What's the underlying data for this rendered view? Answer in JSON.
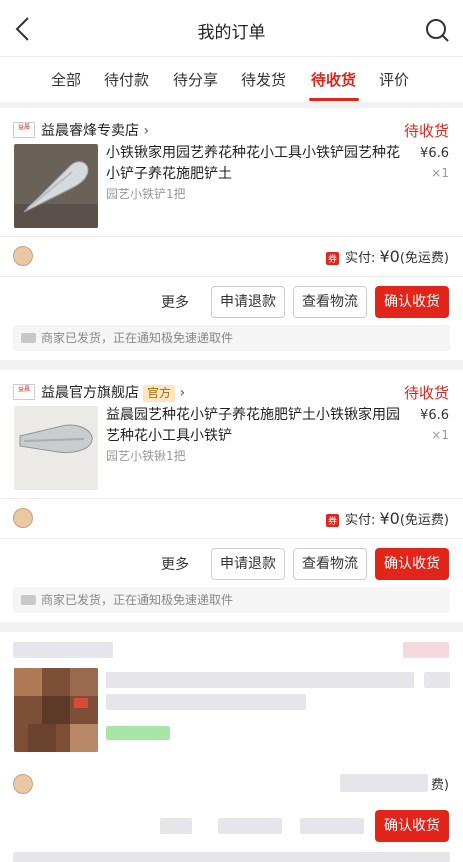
{
  "header": {
    "title": "我的订单"
  },
  "tabs": [
    {
      "label": "全部"
    },
    {
      "label": "待付款"
    },
    {
      "label": "待分享"
    },
    {
      "label": "待发货"
    },
    {
      "label": "待收货"
    },
    {
      "label": "评价"
    }
  ],
  "active_tab": "待收货",
  "orders": [
    {
      "shop": {
        "name": "益晨睿烽专卖店",
        "logo": "益晨"
      },
      "status": "待收货",
      "product": {
        "name": "小铁锹家用园艺养花种花小工具小铁铲园艺种花小铲子养花施肥铲土",
        "price": "¥6.6",
        "qty": "×1",
        "spec": "园艺小铁铲1把"
      },
      "paid": {
        "tag": "券",
        "label": "实付: ",
        "amount": "¥0",
        "note": "(免运费)"
      },
      "buttons": {
        "more": "更多",
        "refund": "申请退款",
        "logistics": "查看物流",
        "confirm": "确认收货"
      },
      "notice": "商家已发货，正在通知极免速递取件"
    },
    {
      "shop": {
        "name": "益晨官方旗舰店",
        "logo": "益晨",
        "badge": "官方"
      },
      "status": "待收货",
      "product": {
        "name": "益晨园艺种花小铲子养花施肥铲土小铁锹家用园艺种花小工具小铁铲",
        "price": "¥6.6",
        "qty": "×1",
        "spec": "园艺小铁锹1把"
      },
      "paid": {
        "tag": "券",
        "label": "实付: ",
        "amount": "¥0",
        "note": "(免运费)"
      },
      "buttons": {
        "more": "更多",
        "refund": "申请退款",
        "logistics": "查看物流",
        "confirm": "确认收货"
      },
      "notice": "商家已发货，正在通知极免速递取件"
    },
    {
      "paid_partial": "费)",
      "buttons": {
        "confirm": "确认收货"
      }
    }
  ],
  "colors": {
    "accent": "#e1251b",
    "official_badge_bg": "#fbe6bd"
  }
}
